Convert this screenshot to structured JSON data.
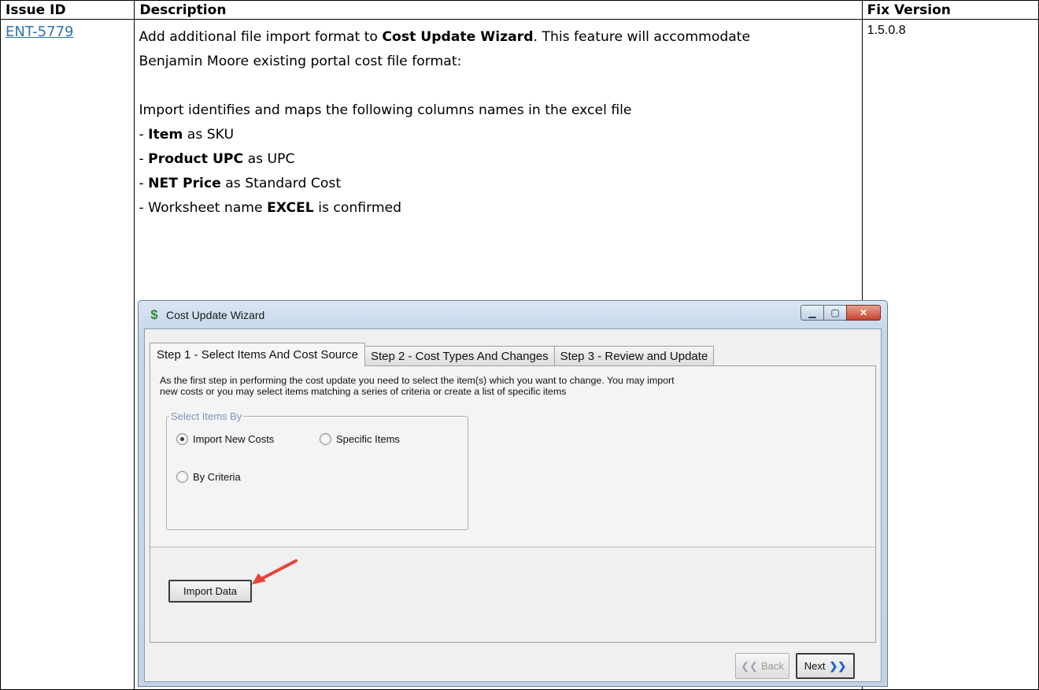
{
  "table": {
    "headers": [
      "Issue ID",
      "Description",
      "Fix Version"
    ],
    "row": {
      "issue_id": "ENT-5779",
      "fix_version": "1.5.0.8",
      "desc": {
        "l1_pre": "Add additional file import format to ",
        "l1_bold": "Cost Update Wizard",
        "l1_post": ".  This feature will accommodate",
        "l2": "Benjamin Moore existing portal cost file format:",
        "l3": "Import identifies and maps the following columns names in the excel file",
        "items": [
          {
            "pre": "- ",
            "bold": "Item",
            "post": " as SKU"
          },
          {
            "pre": "- ",
            "bold": "Product UPC",
            "post": " as UPC"
          },
          {
            "pre": "- ",
            "bold": "NET Price",
            "post": " as Standard Cost"
          },
          {
            "pre": "- Worksheet name ",
            "bold": "EXCEL",
            "post": " is confirmed"
          }
        ]
      }
    }
  },
  "window": {
    "title": "Cost Update Wizard",
    "icon": "dollar-icon",
    "tabs": [
      "Step 1 - Select Items And Cost Source",
      "Step 2 - Cost Types And Changes",
      "Step 3 - Review and Update"
    ],
    "intro_line1": "As the first step in performing the cost update you need to select the item(s) which you want to change.  You may import",
    "intro_line2": "new costs or you may select items matching a series of criteria or create a list of specific items",
    "group_label": "Select Items By",
    "radios": {
      "import_new_costs": "Import New Costs",
      "specific_items": "Specific Items",
      "by_criteria": "By Criteria",
      "selected": "import_new_costs"
    },
    "import_button": "Import Data",
    "back_button": "Back",
    "next_button": "Next",
    "annotation_color": "#e8413a"
  }
}
